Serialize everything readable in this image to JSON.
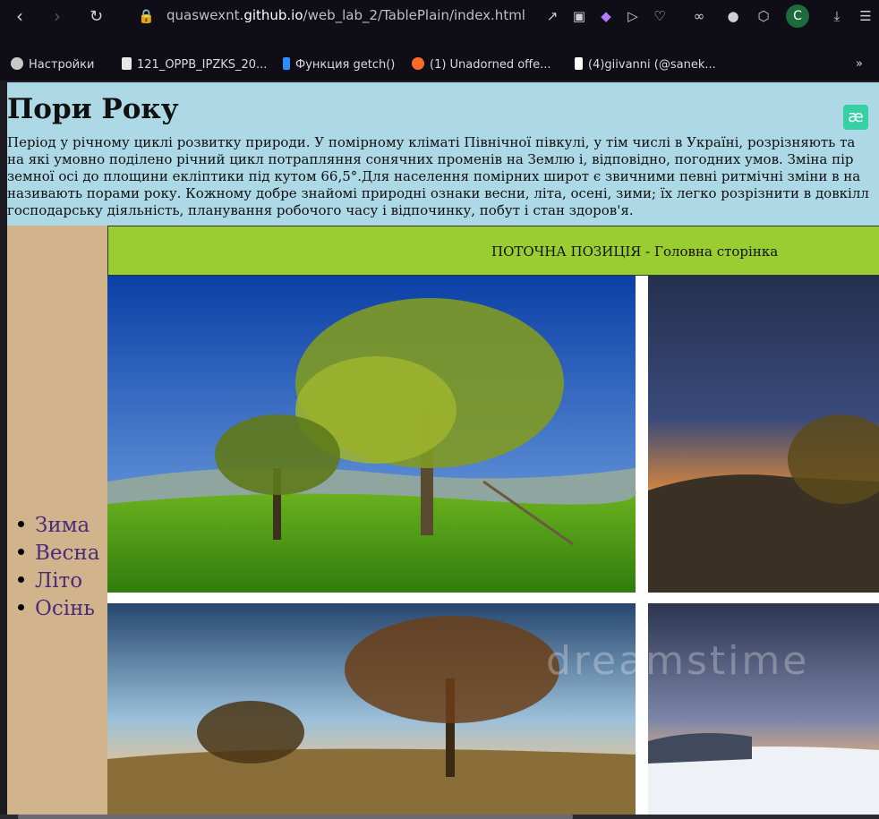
{
  "browser": {
    "url_prefix": "quaswexnt.",
    "url_domain": "github.io",
    "url_path": "/web_lab_2/TablePlain/index.html",
    "avatar_letter": "C",
    "bookmarks": [
      {
        "label": "Настройки",
        "icon": "gear-icon",
        "color": "#c8c8c8"
      },
      {
        "label": "121_OPPB_IPZKS_20...",
        "icon": "document-icon",
        "color": "#e8e8e8"
      },
      {
        "label": "Функция getch()",
        "icon": "s-logo-icon",
        "color": "#2d8cff"
      },
      {
        "label": "(1) Unadorned offe...",
        "icon": "reddit-icon",
        "color": "#ff6a2b"
      },
      {
        "label": "(4)giivanni (@sanek...",
        "icon": "tiktok-icon",
        "color": "#ffffff"
      }
    ],
    "more_label": "»"
  },
  "page": {
    "title": "Пори Року",
    "intro_lines": [
      "Період у річному циклі розвитку природи. У помірному кліматі Північної півкулі, у тім числі в Україні, розрізняють та",
      "на які умовно поділено річний цикл потрапляння сонячних променів на Землю і, відповідно, погодних умов. Зміна пір",
      "земної осі до площини екліптики під кутом 66,5°.Для населення помірних широт є звичними певні ритмічні зміни в на",
      "називають порами року. Кожному добре знайомі природні ознаки весни, літа, осені, зими; їх легко розрізнити в довкілл",
      "господарську діяльність, планування робочого часу і відпочинку, побут і стан здоров'я."
    ],
    "extension_badge": "æ",
    "menu": [
      "Зима",
      "Весна",
      "Літо",
      "Осінь"
    ],
    "position_text": "ПОТОЧНА ПОЗИЦІЯ - Головна сторінка",
    "watermark": "dreamstime"
  },
  "colors": {
    "header_bg": "#add8e6",
    "sidebar_bg": "#d2b48c",
    "position_bg": "#9acd32",
    "link": "#4a2c7a"
  }
}
